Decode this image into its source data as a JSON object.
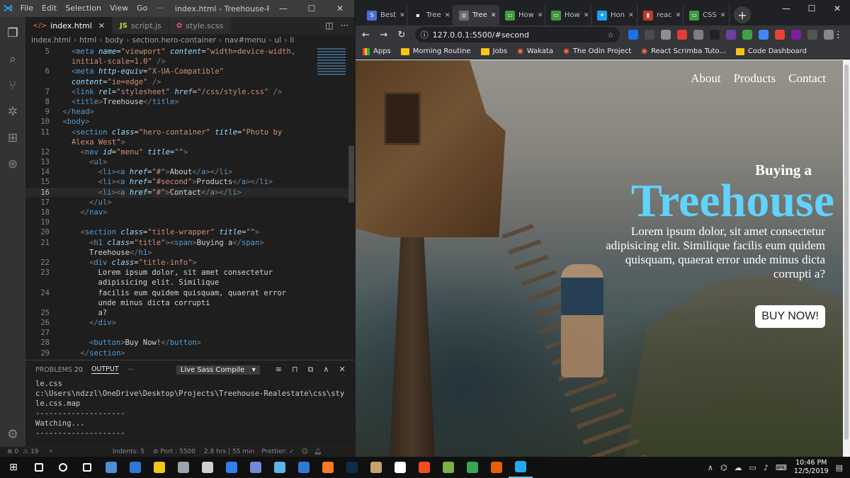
{
  "vscode": {
    "menu": [
      "File",
      "Edit",
      "Selection",
      "View",
      "Go",
      "···"
    ],
    "window_title": "index.html - Treehouse-Realestate - ...",
    "tabs": [
      {
        "label": "index.html",
        "icon": "html-file-icon"
      },
      {
        "label": "script.js",
        "icon": "js-file-icon"
      },
      {
        "label": "style.scss",
        "icon": "scss-file-icon"
      }
    ],
    "breadcrumb": [
      "index.html",
      "html",
      "body",
      "section.hero-container",
      "nav#menu",
      "ul",
      "li"
    ],
    "code_lines": [
      {
        "n": "5",
        "html": "<span class='t-tag'>&lt;</span><span class='t-name'>meta</span> <span class='t-attr t-em'>name</span><span class='t-text'>=</span><span class='t-str'>\"viewport\"</span> <span class='t-attr t-em'>content</span><span class='t-text'>=</span><span class='t-str'>\"width=device-width,</span>"
      },
      {
        "n": "",
        "html": "<span class='t-str'>initial-scale=1.0\"</span> <span class='t-tag'>/&gt;</span>"
      },
      {
        "n": "6",
        "html": "<span class='t-tag'>&lt;</span><span class='t-name'>meta</span> <span class='t-attr t-em'>http-equiv</span><span class='t-text'>=</span><span class='t-str'>\"X-UA-Compatible\"</span>"
      },
      {
        "n": "",
        "html": "<span class='t-attr t-em'>content</span><span class='t-text'>=</span><span class='t-str'>\"ie=edge\"</span> <span class='t-tag'>/&gt;</span>"
      },
      {
        "n": "7",
        "html": "<span class='t-tag'>&lt;</span><span class='t-name'>link</span> <span class='t-attr t-em'>rel</span><span class='t-text'>=</span><span class='t-str'>\"stylesheet\"</span> <span class='t-attr t-em'>href</span><span class='t-text'>=</span><span class='t-str'>\"/css/style.css\"</span> <span class='t-tag'>/&gt;</span>"
      },
      {
        "n": "8",
        "html": "<span class='t-tag'>&lt;</span><span class='t-name'>title</span><span class='t-tag'>&gt;</span><span class='t-text'>Treehouse</span><span class='t-tag'>&lt;/</span><span class='t-name'>title</span><span class='t-tag'>&gt;</span>"
      },
      {
        "n": "9",
        "html": "<span class='t-tag'>&lt;/</span><span class='t-name'>head</span><span class='t-tag'>&gt;</span>"
      },
      {
        "n": "10",
        "html": "<span class='t-tag'>&lt;</span><span class='t-name'>body</span><span class='t-tag'>&gt;</span>"
      },
      {
        "n": "11",
        "html": "<span class='t-tag'>&lt;</span><span class='t-name'>section</span> <span class='t-attr t-em'>class</span><span class='t-text'>=</span><span class='t-str'>\"hero-container\"</span> <span class='t-attr t-em'>title</span><span class='t-text'>=</span><span class='t-str'>\"Photo by</span>"
      },
      {
        "n": "",
        "html": "<span class='t-str'>Alexa West\"</span><span class='t-tag'>&gt;</span>"
      },
      {
        "n": "12",
        "html": "<span class='t-tag'>&lt;</span><span class='t-name'>nav</span> <span class='t-attr t-em'>id</span><span class='t-text'>=</span><span class='t-str'>\"menu\"</span> <span class='t-attr t-em'>title</span><span class='t-text'>=</span><span class='t-str'>\"\"</span><span class='t-tag'>&gt;</span>"
      },
      {
        "n": "13",
        "html": "<span class='t-tag'>&lt;</span><span class='t-name'>ul</span><span class='t-tag'>&gt;</span>"
      },
      {
        "n": "14",
        "html": "<span class='t-tag'>&lt;</span><span class='t-name'>li</span><span class='t-tag'>&gt;&lt;</span><span class='t-name'>a</span> <span class='t-attr t-em'>href</span><span class='t-text'>=</span><span class='t-str'>\"#\"</span><span class='t-tag'>&gt;</span><span class='t-text'>About</span><span class='t-tag'>&lt;/</span><span class='t-name'>a</span><span class='t-tag'>&gt;&lt;/</span><span class='t-name'>li</span><span class='t-tag'>&gt;</span>"
      },
      {
        "n": "15",
        "html": "<span class='t-tag'>&lt;</span><span class='t-name'>li</span><span class='t-tag'>&gt;&lt;</span><span class='t-name'>a</span> <span class='t-attr t-em'>href</span><span class='t-text'>=</span><span class='t-str'>\"#second\"</span><span class='t-tag'>&gt;</span><span class='t-text'>Products</span><span class='t-tag'>&lt;/</span><span class='t-name'>a</span><span class='t-tag'>&gt;&lt;/</span><span class='t-name'>li</span><span class='t-tag'>&gt;</span>"
      },
      {
        "n": "16",
        "html": "<span class='t-tag'>&lt;</span><span class='t-name'>li</span><span class='t-tag'>&gt;&lt;</span><span class='t-name'>a</span> <span class='t-attr t-em'>href</span><span class='t-text'>=</span><span class='t-str'>\"#\"</span><span class='t-tag'>&gt;</span><span class='t-text'>Contact</span><span class='t-tag'>&lt;/</span><span class='t-name'>a</span><span class='t-tag'>&gt;&lt;/</span><span class='t-name'>li</span><span class='t-tag'>&gt;</span>",
        "current": true
      },
      {
        "n": "17",
        "html": "<span class='t-tag'>&lt;/</span><span class='t-name'>ul</span><span class='t-tag'>&gt;</span>"
      },
      {
        "n": "18",
        "html": "<span class='t-tag'>&lt;/</span><span class='t-name'>nav</span><span class='t-tag'>&gt;</span>"
      },
      {
        "n": "19",
        "html": ""
      },
      {
        "n": "20",
        "html": "<span class='t-tag'>&lt;</span><span class='t-name'>section</span> <span class='t-attr t-em'>class</span><span class='t-text'>=</span><span class='t-str'>\"title-wrapper\"</span> <span class='t-attr t-em'>title</span><span class='t-text'>=</span><span class='t-str'>\"\"</span><span class='t-tag'>&gt;</span>"
      },
      {
        "n": "21",
        "html": "<span class='t-tag'>&lt;</span><span class='t-name'>h1</span> <span class='t-attr t-em'>class</span><span class='t-text'>=</span><span class='t-str'>\"title\"</span><span class='t-tag'>&gt;&lt;</span><span class='t-name'>span</span><span class='t-tag'>&gt;</span><span class='t-text'>Buying a</span><span class='t-tag'>&lt;/</span><span class='t-name'>span</span><span class='t-tag'>&gt;</span>"
      },
      {
        "n": "",
        "html": "<span class='t-text'>Treehouse</span><span class='t-tag'>&lt;/</span><span class='t-name'>h1</span><span class='t-tag'>&gt;</span>"
      },
      {
        "n": "22",
        "html": "<span class='t-tag'>&lt;</span><span class='t-name'>div</span> <span class='t-attr t-em'>class</span><span class='t-text'>=</span><span class='t-str'>\"title-info\"</span><span class='t-tag'>&gt;</span>"
      },
      {
        "n": "23",
        "html": "<span class='t-text'>Lorem ipsum dolor, sit amet consectetur</span>"
      },
      {
        "n": "",
        "html": "<span class='t-text'>adipisicing elit. Similique</span>"
      },
      {
        "n": "24",
        "html": "<span class='t-text'>facilis eum quidem quisquam, quaerat error</span>"
      },
      {
        "n": "",
        "html": "<span class='t-text'>unde minus dicta corrupti</span>"
      },
      {
        "n": "25",
        "html": "<span class='t-text'>a?</span>"
      },
      {
        "n": "26",
        "html": "<span class='t-tag'>&lt;/</span><span class='t-name'>div</span><span class='t-tag'>&gt;</span>"
      },
      {
        "n": "27",
        "html": ""
      },
      {
        "n": "28",
        "html": "<span class='t-tag'>&lt;</span><span class='t-name'>button</span><span class='t-tag'>&gt;</span><span class='t-text'>Buy Now!</span><span class='t-tag'>&lt;/</span><span class='t-name'>button</span><span class='t-tag'>&gt;</span>"
      },
      {
        "n": "29",
        "html": "<span class='t-tag'>&lt;/</span><span class='t-name'>section</span><span class='t-tag'>&gt;</span>"
      }
    ],
    "panel": {
      "tabs": [
        {
          "label": "PROBLEMS",
          "badge": "20"
        },
        {
          "label": "OUTPUT"
        },
        {
          "label": "···"
        }
      ],
      "select_value": "Live Sass Compile",
      "output_lines": [
        "le.css",
        "c:\\Users\\ndzzl\\OneDrive\\Desktop\\Projects\\Treehouse-Realestate\\css\\sty",
        "le.css.map",
        "--------------------",
        "Watching...",
        "--------------------"
      ]
    },
    "status": {
      "errors": "⊗ 0",
      "warnings": "⚠ 19",
      "indents": "Indents: 5",
      "port": "⊘ Port : 5500",
      "wakatime": "2.8 hrs | 55 min",
      "prettier": "Prettier: ✓"
    }
  },
  "chrome": {
    "tabs": [
      {
        "label": "Best",
        "color": "#4a6fd6",
        "glyph": "S"
      },
      {
        "label": "Tree",
        "color": "#1e1e1e",
        "glyph": "▪"
      },
      {
        "label": "Tree",
        "color": "#6b6b6b",
        "glyph": "◎",
        "active": true
      },
      {
        "label": "How",
        "color": "#3d9b3d",
        "glyph": "▭"
      },
      {
        "label": "How",
        "color": "#3d9b3d",
        "glyph": "▭"
      },
      {
        "label": "Hon",
        "color": "#1da1f2",
        "glyph": "✦"
      },
      {
        "label": "reac",
        "color": "#c0392b",
        "glyph": "▮"
      },
      {
        "label": "CSS",
        "color": "#3d9b3d",
        "glyph": "▭"
      }
    ],
    "url": "127.0.0.1:5500/#second",
    "bookmarks": [
      {
        "label": "Apps",
        "icon": "apps-grid-icon"
      },
      {
        "label": "Morning Routine",
        "icon": "folder-icon"
      },
      {
        "label": "Jobs",
        "icon": "folder-icon"
      },
      {
        "label": "Wakata",
        "icon": "wakatime-icon"
      },
      {
        "label": "The Odin Project",
        "icon": "odin-icon"
      },
      {
        "label": "React Scrimba Tuto...",
        "icon": "scrimba-icon"
      },
      {
        "label": "Code Dashboard",
        "icon": "folder-icon"
      }
    ],
    "extension_colors": [
      "#1a73e8",
      "#4a4a4a",
      "#8e8e8e",
      "#e53935",
      "#7e7e7e",
      "#222",
      "#6b3fa0",
      "#43a047",
      "#4285f4",
      "#ea4335",
      "#7b1fa2",
      "#555",
      "#888"
    ]
  },
  "site": {
    "nav": [
      "About",
      "Products",
      "Contact"
    ],
    "title_pre": "Buying a",
    "title_main": "Treehouse",
    "info": "Lorem ipsum dolor, sit amet consectetur adipisicing elit. Similique facilis eum quidem quisquam, quaerat error unde minus dicta corrupti a?",
    "button": "BUY NOW!",
    "accent_color": "#61d2fb"
  },
  "taskbar": {
    "apps": [
      {
        "name": "search-icon",
        "color": "#ffffff"
      },
      {
        "name": "cortana-icon",
        "color": "#ffffff"
      },
      {
        "name": "task-view-icon",
        "color": "#ffffff"
      },
      {
        "name": "remote-desktop-icon",
        "color": "#4a90d9"
      },
      {
        "name": "store-icon",
        "color": "#2d7ad6"
      },
      {
        "name": "file-explorer-icon",
        "color": "#f5c518"
      },
      {
        "name": "photos-icon",
        "color": "#9aa5b1"
      },
      {
        "name": "calculator-icon",
        "color": "#d0d0d0"
      },
      {
        "name": "todo-icon",
        "color": "#2f80ed"
      },
      {
        "name": "discord-icon",
        "color": "#7289da"
      },
      {
        "name": "notebook-icon",
        "color": "#5bb5e6"
      },
      {
        "name": "maps-icon",
        "color": "#2d7ad6"
      },
      {
        "name": "xampp-icon",
        "color": "#fb7a24"
      },
      {
        "name": "photoshop-icon",
        "color": "#0b2c4a"
      },
      {
        "name": "paint-icon",
        "color": "#c9a26b"
      },
      {
        "name": "capture-icon",
        "color": "#ffffff"
      },
      {
        "name": "figma-icon",
        "color": "#f24e1e"
      },
      {
        "name": "lambda-icon",
        "color": "#7cb342"
      },
      {
        "name": "chrome-icon",
        "color": "#34a853"
      },
      {
        "name": "firefox-icon",
        "color": "#e66000"
      },
      {
        "name": "vscode-icon",
        "color": "#23a9f2",
        "active": true
      }
    ],
    "time": "10:46 PM",
    "date": "12/5/2019"
  }
}
